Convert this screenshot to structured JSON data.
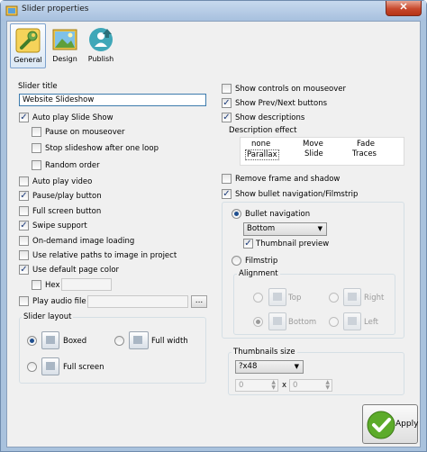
{
  "window": {
    "title": "Slider properties",
    "close_glyph": "✕"
  },
  "tabs": [
    {
      "label": "General",
      "icon": "wrench-icon"
    },
    {
      "label": "Design",
      "icon": "picture-icon"
    },
    {
      "label": "Publish",
      "icon": "upload-person-icon"
    }
  ],
  "general": {
    "slider_title_label": "Slider title",
    "slider_title_value": "Website Slideshow",
    "auto_play_slideshow": "Auto play Slide Show",
    "pause_on_mouseover": "Pause on mouseover",
    "stop_after_loop": "Stop slideshow after one loop",
    "random_order": "Random order",
    "auto_play_video": "Auto play video",
    "pause_play_button": "Pause/play button",
    "full_screen_button": "Full screen button",
    "swipe_support": "Swipe support",
    "on_demand_loading": "On-demand image loading",
    "relative_paths": "Use relative paths to image in project",
    "default_page_color": "Use default page color",
    "hex_label": "Hex",
    "hex_value": "",
    "play_audio_file": "Play audio file",
    "audio_file_value": "",
    "browse_label": "...",
    "slider_layout": {
      "title": "Slider layout",
      "boxed": "Boxed",
      "full_width": "Full width",
      "full_screen": "Full screen"
    }
  },
  "right": {
    "show_controls_mouseover": "Show controls on mouseover",
    "show_prev_next": "Show Prev/Next buttons",
    "show_descriptions": "Show descriptions",
    "description_effect_label": "Description effect",
    "effects": [
      "none",
      "Move",
      "Fade",
      "Parallax",
      "Slide",
      "Traces"
    ],
    "remove_frame_shadow": "Remove frame and shadow",
    "show_bullet_nav": "Show bullet navigation/Filmstrip",
    "bullet_navigation": "Bullet navigation",
    "bullet_position": "Bottom",
    "thumbnail_preview": "Thumbnail preview",
    "filmstrip": "Filmstrip",
    "alignment": {
      "title": "Alignment",
      "top": "Top",
      "right": "Right",
      "bottom": "Bottom",
      "left": "Left"
    },
    "thumbnails_size": {
      "title": "Thumbnails size",
      "value": "?x48",
      "width": "0",
      "times": "x",
      "height": "0"
    }
  },
  "apply_label": "Apply",
  "colors": {
    "accent": "#1f4f8f",
    "apply_green": "#5cab2a"
  }
}
